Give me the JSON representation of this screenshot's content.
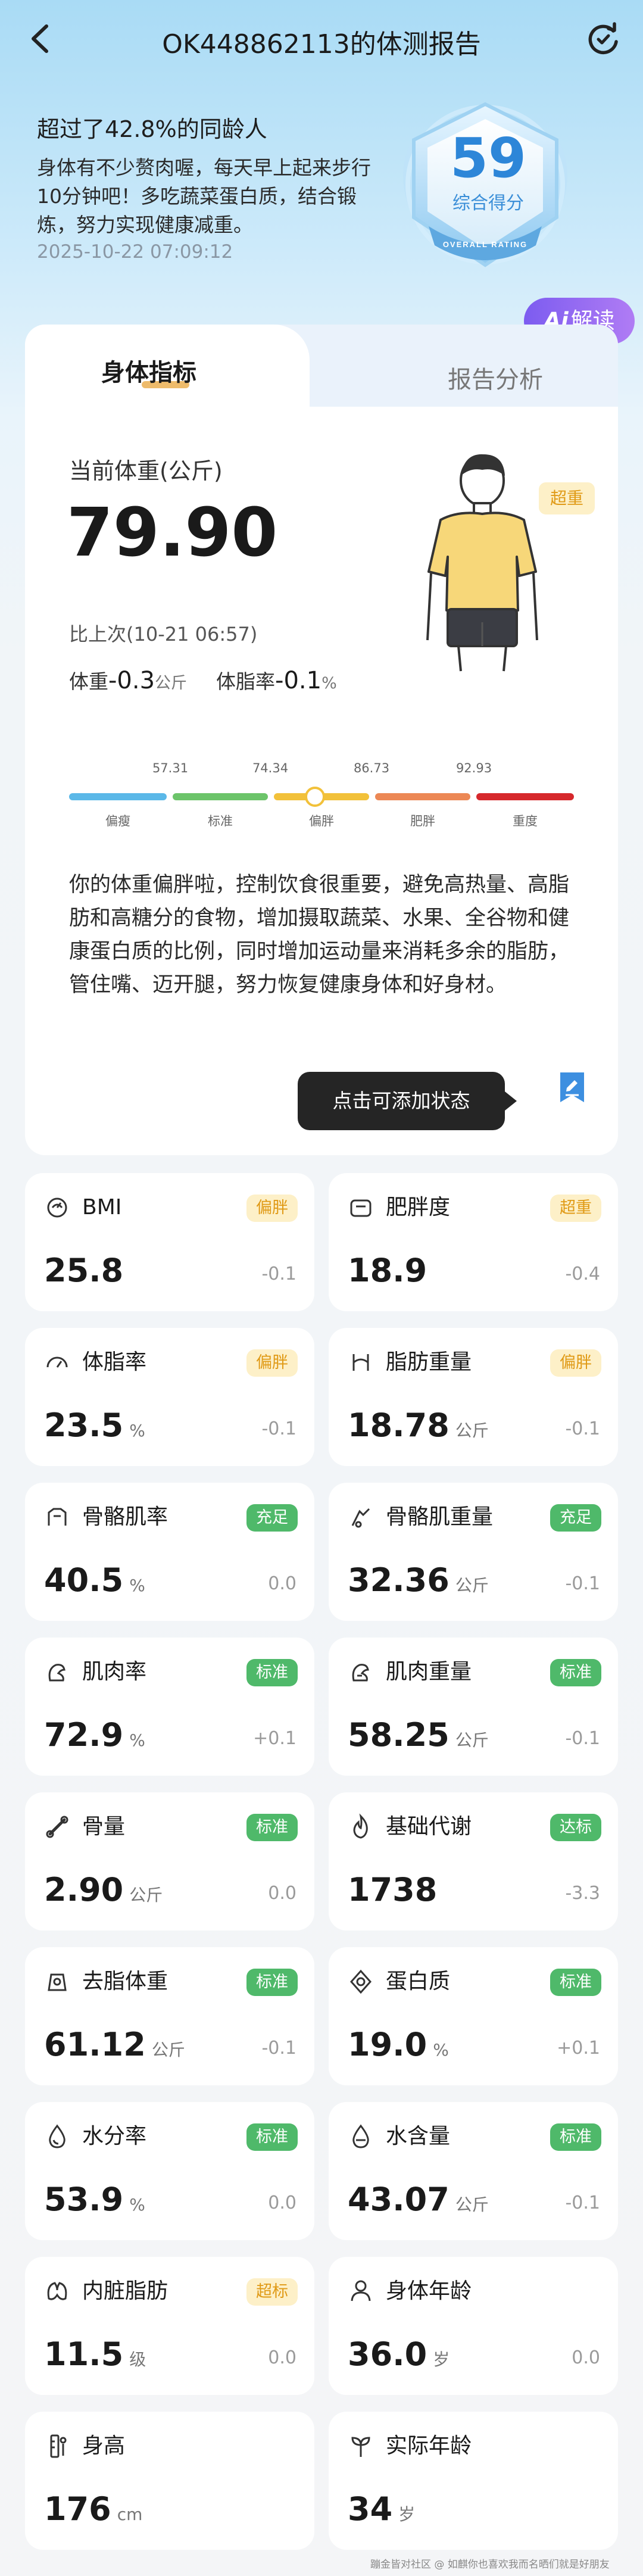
{
  "header": {
    "title": "OK448862113的体测报告"
  },
  "summary": {
    "headline": "超过了42.8%的同龄人",
    "description": "身体有不少赘肉喔，每天早上起来步行10分钟吧！多吃蔬菜蛋白质，结合锻炼，努力实现健康减重。",
    "date": "2025-10-22 07:09:12",
    "score": "59",
    "score_label": "综合得分",
    "badge_text": "OVERALL RATING"
  },
  "ai_button": {
    "icon": "Ai",
    "label": "解读"
  },
  "tabs": [
    {
      "label": "身体指标"
    },
    {
      "label": "报告分析"
    }
  ],
  "weight": {
    "label": "当前体重(公斤)",
    "value": "79.90",
    "status": "超重",
    "compare_label": "比上次(10-21 06:57)",
    "weight_label": "体重",
    "weight_delta": "-0.3",
    "weight_unit": "公斤",
    "fat_label": "体脂率",
    "fat_delta": "-0.1",
    "fat_unit": "%"
  },
  "scale": {
    "ticks": [
      "57.31",
      "74.34",
      "86.73",
      "92.93"
    ],
    "segments": [
      {
        "label": "偏瘦",
        "color": "#5bb8e8"
      },
      {
        "label": "标准",
        "color": "#6cc46a"
      },
      {
        "label": "偏胖",
        "color": "#f2c13a"
      },
      {
        "label": "肥胖",
        "color": "#ec8855"
      },
      {
        "label": "重度",
        "color": "#d6282c"
      }
    ]
  },
  "analysis_text": "你的体重偏胖啦，控制饮食很重要，避免高热量、高脂肪和高糖分的食物，增加摄取蔬菜、水果、全谷物和健康蛋白质的比例，同时增加运动量来消耗多余的脂肪，管住嘴、迈开腿，努力恢复健康身体和好身材。",
  "tooltip": "点击可添加状态",
  "colors": {
    "accent": "#2d86d8",
    "tag_orange_bg": "#fdf0c8",
    "tag_orange_fg": "#e09a16",
    "tag_green_bg": "#4fb96a",
    "tag_green_fg": "#ffffff"
  },
  "metrics": [
    {
      "name": "BMI",
      "icon": "bmi-icon",
      "tag": "偏胖",
      "tag_style": "orange",
      "value": "25.8",
      "unit": "",
      "delta": "-0.1"
    },
    {
      "name": "肥胖度",
      "icon": "scale-icon",
      "tag": "超重",
      "tag_style": "orange",
      "value": "18.9",
      "unit": "",
      "delta": "-0.4"
    },
    {
      "name": "体脂率",
      "icon": "gauge-icon",
      "tag": "偏胖",
      "tag_style": "orange",
      "value": "23.5",
      "unit": "%",
      "delta": "-0.1"
    },
    {
      "name": "脂肪重量",
      "icon": "body-fat-icon",
      "tag": "偏胖",
      "tag_style": "orange",
      "value": "18.78",
      "unit": "公斤",
      "delta": "-0.1"
    },
    {
      "name": "骨骼肌率",
      "icon": "muscle-icon",
      "tag": "充足",
      "tag_style": "green",
      "value": "40.5",
      "unit": "%",
      "delta": "0.0"
    },
    {
      "name": "骨骼肌重量",
      "icon": "muscle-weight-icon",
      "tag": "充足",
      "tag_style": "green",
      "value": "32.36",
      "unit": "公斤",
      "delta": "-0.1"
    },
    {
      "name": "肌肉率",
      "icon": "arm-icon",
      "tag": "标准",
      "tag_style": "green",
      "value": "72.9",
      "unit": "%",
      "delta": "+0.1"
    },
    {
      "name": "肌肉重量",
      "icon": "arm-weight-icon",
      "tag": "标准",
      "tag_style": "green",
      "value": "58.25",
      "unit": "公斤",
      "delta": "-0.1"
    },
    {
      "name": "骨量",
      "icon": "bone-icon",
      "tag": "标准",
      "tag_style": "green",
      "value": "2.90",
      "unit": "公斤",
      "delta": "0.0"
    },
    {
      "name": "基础代谢",
      "icon": "flame-icon",
      "tag": "达标",
      "tag_style": "green",
      "value": "1738",
      "unit": "",
      "delta": "-3.3"
    },
    {
      "name": "去脂体重",
      "icon": "lean-weight-icon",
      "tag": "标准",
      "tag_style": "green",
      "value": "61.12",
      "unit": "公斤",
      "delta": "-0.1"
    },
    {
      "name": "蛋白质",
      "icon": "protein-icon",
      "tag": "标准",
      "tag_style": "green",
      "value": "19.0",
      "unit": "%",
      "delta": "+0.1"
    },
    {
      "name": "水分率",
      "icon": "water-drop-icon",
      "tag": "标准",
      "tag_style": "green",
      "value": "53.9",
      "unit": "%",
      "delta": "0.0"
    },
    {
      "name": "水含量",
      "icon": "water-content-icon",
      "tag": "标准",
      "tag_style": "green",
      "value": "43.07",
      "unit": "公斤",
      "delta": "-0.1"
    },
    {
      "name": "内脏脂肪",
      "icon": "organ-icon",
      "tag": "超标",
      "tag_style": "orange",
      "value": "11.5",
      "unit": "级",
      "delta": "0.0"
    },
    {
      "name": "身体年龄",
      "icon": "person-icon",
      "tag": "",
      "tag_style": "",
      "value": "36.0",
      "unit": "岁",
      "delta": "0.0"
    },
    {
      "name": "身高",
      "icon": "ruler-icon",
      "tag": "",
      "tag_style": "",
      "value": "176",
      "unit": "cm",
      "delta": ""
    },
    {
      "name": "实际年龄",
      "icon": "sprout-icon",
      "tag": "",
      "tag_style": "",
      "value": "34",
      "unit": "岁",
      "delta": ""
    }
  ],
  "footer": "蹦金皆对社区 @ 如麒你也喜欢我而名晒们就是好朋友"
}
